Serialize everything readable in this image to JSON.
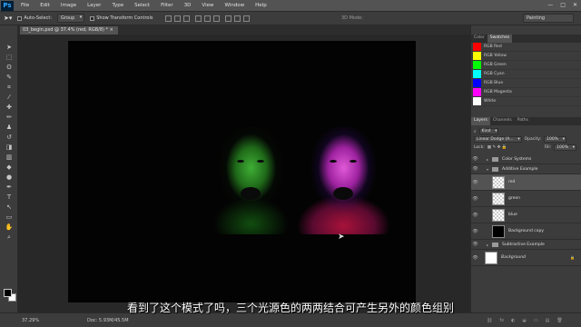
{
  "app": {
    "logo": "Ps"
  },
  "menu": [
    "File",
    "Edit",
    "Image",
    "Layer",
    "Type",
    "Select",
    "Filter",
    "3D",
    "View",
    "Window",
    "Help"
  ],
  "window_controls": [
    "—",
    "□",
    "✕"
  ],
  "options_bar": {
    "auto_select_label": "Auto-Select:",
    "auto_select_value": "Group",
    "transform_label": "Show Transform Controls",
    "mode_3d": "3D Mode:",
    "workspace": "Painting"
  },
  "document_tab": "03_begin.psd @ 37.4% (red, RGB/8) *  ×",
  "tools": [
    "move-tool",
    "marquee-tool",
    "lasso-tool",
    "quick-select-tool",
    "crop-tool",
    "eyedropper-tool",
    "healing-tool",
    "brush-tool",
    "stamp-tool",
    "history-brush-tool",
    "eraser-tool",
    "gradient-tool",
    "blur-tool",
    "dodge-tool",
    "pen-tool",
    "type-tool",
    "path-select-tool",
    "shape-tool",
    "hand-tool",
    "zoom-tool"
  ],
  "tool_glyphs": [
    "➤",
    "⬚",
    "ʘ",
    "✎",
    "⌗",
    "⁄",
    "✚",
    "✏",
    "♟",
    "↺",
    "◨",
    "▥",
    "◆",
    "●",
    "✒",
    "T",
    "↖",
    "▭",
    "✋",
    "⌕"
  ],
  "swatches_panel": {
    "tabs": [
      "Color",
      "Swatches"
    ],
    "items": [
      {
        "name": "RGB Red",
        "color": "#ff0000"
      },
      {
        "name": "RGB Yellow",
        "color": "#ffff00"
      },
      {
        "name": "RGB Green",
        "color": "#00ff00"
      },
      {
        "name": "RGB Cyan",
        "color": "#00ffff"
      },
      {
        "name": "RGB Blue",
        "color": "#0000ff"
      },
      {
        "name": "RGB Magenta",
        "color": "#ff00ff"
      },
      {
        "name": "White",
        "color": "#ffffff"
      }
    ]
  },
  "layers_panel": {
    "tabs": [
      "Layers",
      "Channels",
      "Paths"
    ],
    "kind": "Kind",
    "blend_mode": "Linear Dodge (A...",
    "opacity_label": "Opacity:",
    "opacity_value": "100%",
    "lock_label": "Lock:",
    "fill_label": "Fill:",
    "fill_value": "100%",
    "layers": [
      {
        "name": "Color Systems",
        "type": "group",
        "indent": 0
      },
      {
        "name": "Additive Example",
        "type": "group",
        "indent": 0
      },
      {
        "name": "red",
        "type": "pixel",
        "indent": 1,
        "selected": true
      },
      {
        "name": "green",
        "type": "pixel",
        "indent": 1
      },
      {
        "name": "blue",
        "type": "pixel",
        "indent": 1
      },
      {
        "name": "Background copy",
        "type": "black",
        "indent": 1
      },
      {
        "name": "Subtractive Example",
        "type": "group",
        "indent": 0
      },
      {
        "name": "Background",
        "type": "white",
        "indent": 0
      }
    ]
  },
  "status": {
    "zoom": "37.29%",
    "doc": "Doc: 5.93M/45.5M"
  },
  "subtitle": "看到了这个模式了吗，三个光源色的两两结合可产生另外的颜色组别"
}
